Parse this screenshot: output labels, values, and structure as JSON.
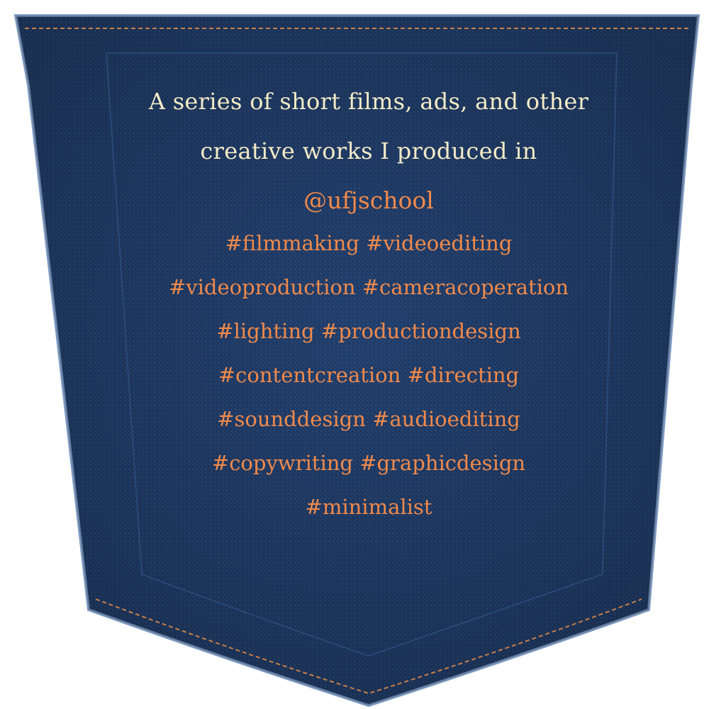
{
  "colors": {
    "denim": "#1f3b68",
    "intro_text": "#f3ebc8",
    "accent_text": "#f08a4b",
    "stitch": "#c8804a"
  },
  "intro": {
    "line1": "A series of short films, ads, and other",
    "line2": "creative works I produced in"
  },
  "handle": "@ufjschool",
  "hashtag_lines": [
    "#filmmaking #videoediting",
    "#videoproduction #cameracoperation",
    "#lighting #productiondesign",
    "#contentcreation #directing",
    "#sounddesign #audioediting",
    "#copywriting #graphicdesign",
    "#minimalist"
  ]
}
